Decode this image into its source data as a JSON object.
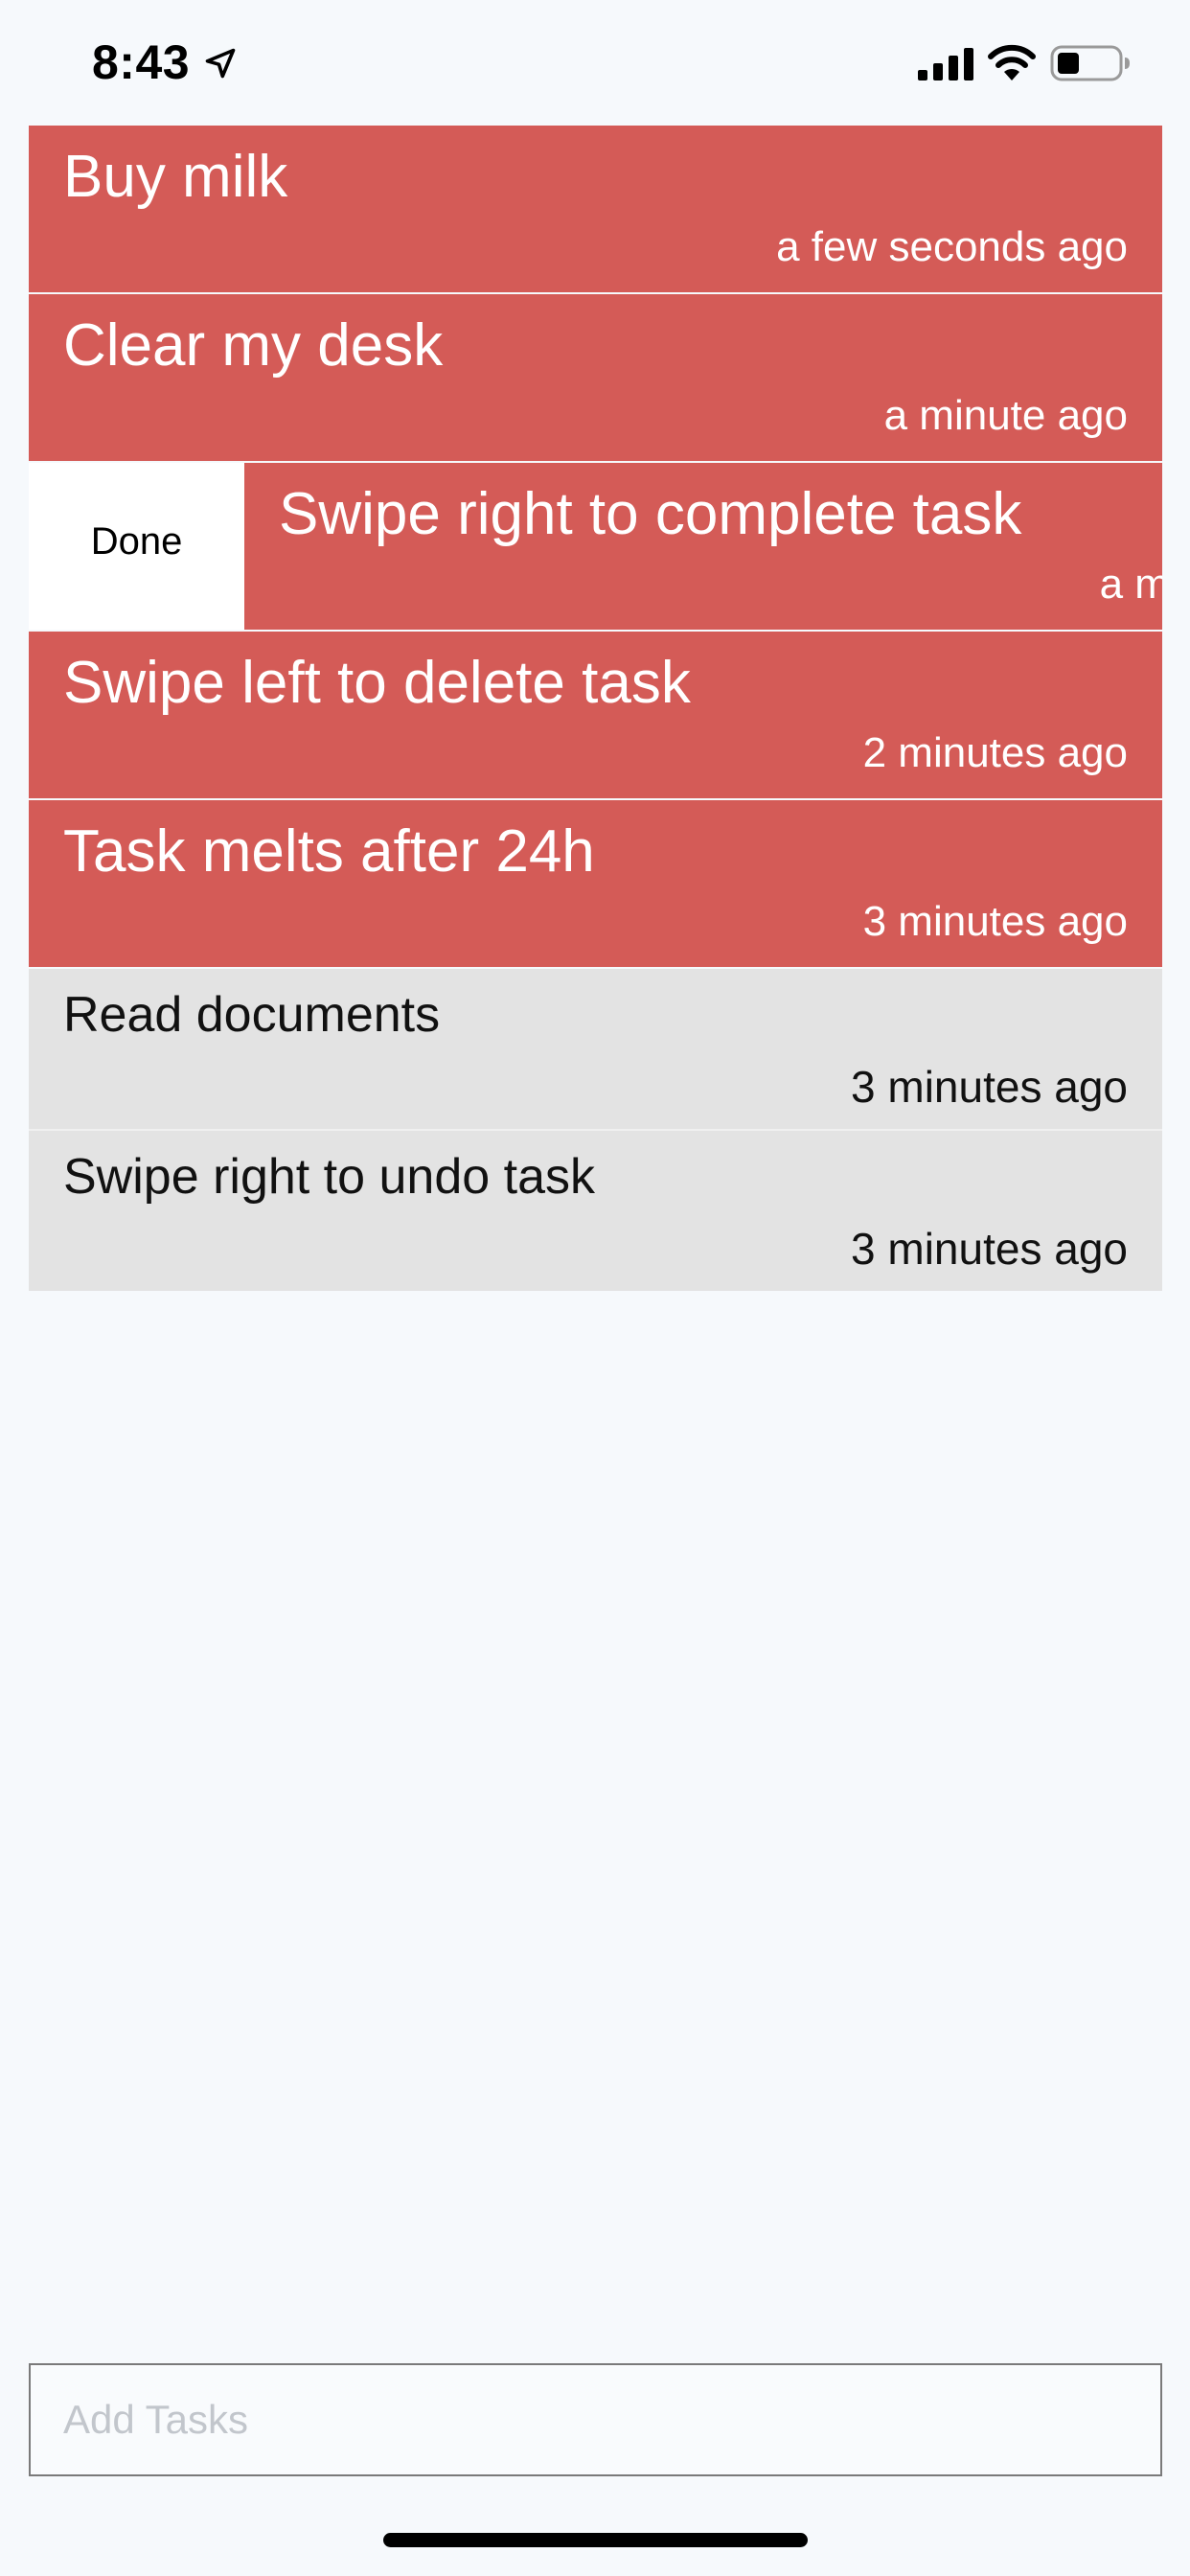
{
  "status_bar": {
    "time": "8:43",
    "icons": [
      "location-arrow-icon",
      "cellular-signal-icon",
      "wifi-icon",
      "battery-icon"
    ]
  },
  "tasks": {
    "active": [
      {
        "title": "Buy milk",
        "time": "a few seconds ago"
      },
      {
        "title": "Clear my desk",
        "time": "a minute ago"
      },
      {
        "title": "Swipe right to complete task",
        "time": "a minute ago",
        "swipe_action": "Done"
      },
      {
        "title": "Swipe left to delete task",
        "time": "2 minutes ago"
      },
      {
        "title": "Task melts after 24h",
        "time": "3 minutes ago"
      }
    ],
    "completed": [
      {
        "title": "Read documents",
        "time": "3 minutes ago"
      },
      {
        "title": "Swipe right to undo task",
        "time": "3 minutes ago"
      }
    ]
  },
  "add_task": {
    "placeholder": "Add Tasks",
    "value": ""
  },
  "colors": {
    "active_task": "#d45b57",
    "completed_task": "#e3e3e3",
    "background": "#f6f9fc"
  }
}
